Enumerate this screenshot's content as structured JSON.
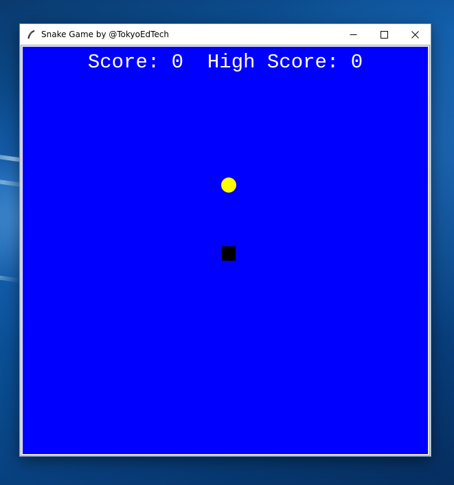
{
  "window": {
    "title": "Snake Game by @TokyoEdTech",
    "icon": "feather-icon",
    "controls": [
      "minimize-icon",
      "maximize-icon",
      "close-icon"
    ]
  },
  "game": {
    "score_label": "Score:",
    "score": "0",
    "high_score_label": "High Score:",
    "high_score": "0",
    "background_color": "#0000ff",
    "food_color": "#ffff00",
    "snake_color": "#000000"
  }
}
